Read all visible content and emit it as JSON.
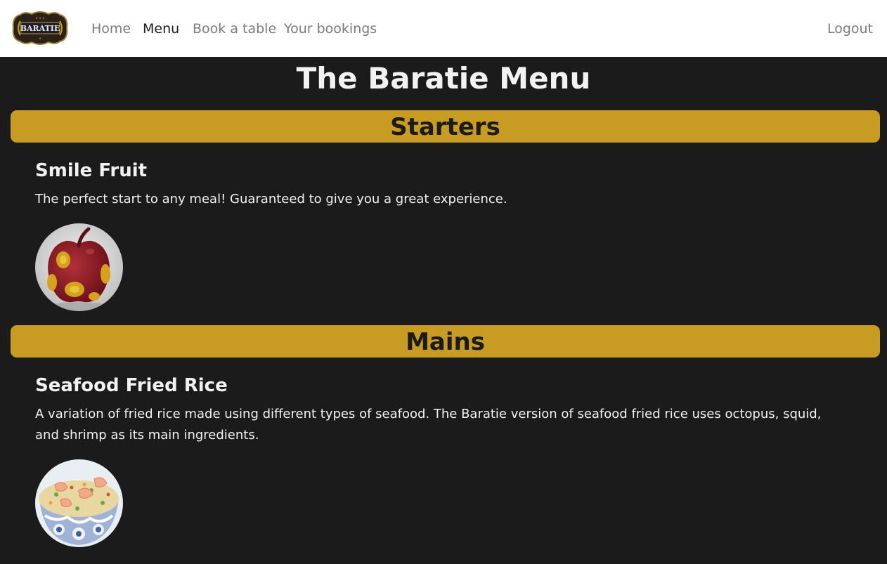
{
  "nav": {
    "logo_text": "BARATIE",
    "links": [
      {
        "label": "Home",
        "active": false
      },
      {
        "label": "Menu",
        "active": true
      },
      {
        "label": "Book a table",
        "active": false
      },
      {
        "label": "Your bookings",
        "active": false
      }
    ],
    "logout_label": "Logout"
  },
  "page": {
    "title": "The Baratie Menu"
  },
  "sections": [
    {
      "heading": "Starters",
      "items": [
        {
          "name": "Smile Fruit",
          "description": "The perfect start to any meal! Guaranteed to give you a great experience.",
          "image_icon": "smile-fruit-image"
        }
      ]
    },
    {
      "heading": "Mains",
      "items": [
        {
          "name": "Seafood Fried Rice",
          "description": "A variation of fried rice made using different types of seafood. The Baratie version of seafood fried rice uses octopus, squid, and shrimp as its main ingredients.",
          "image_icon": "seafood-fried-rice-image"
        }
      ]
    }
  ],
  "colors": {
    "background": "#1b1b1b",
    "section_bar": "#c89b22",
    "navbar": "#ffffff",
    "text_light": "#f2f2f2"
  }
}
